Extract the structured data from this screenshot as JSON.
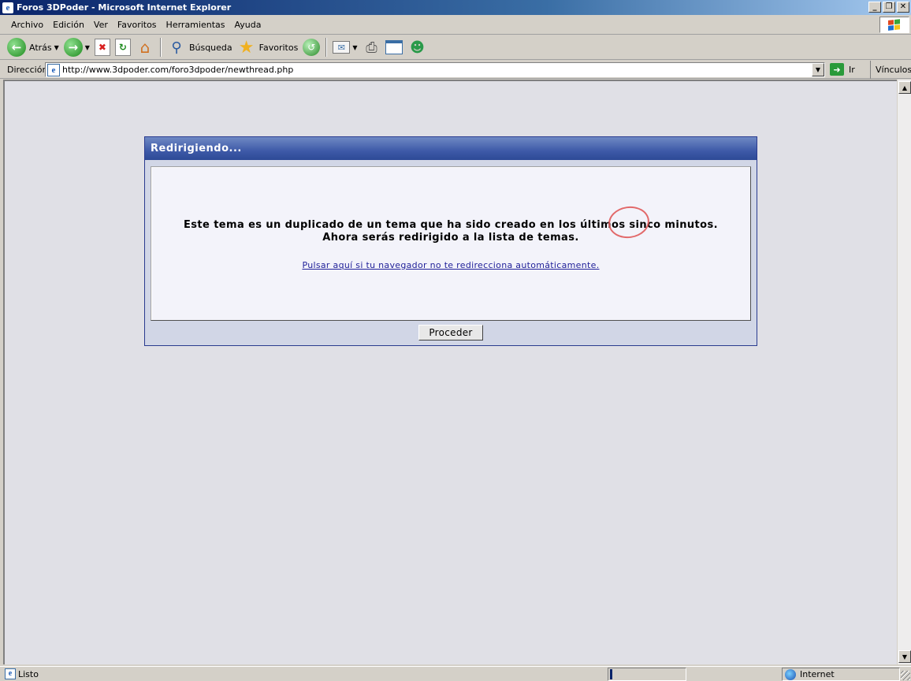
{
  "window": {
    "title": "Foros 3DPoder - Microsoft Internet Explorer",
    "app_icon_glyph": "e",
    "controls": {
      "minimize": "_",
      "restore": "❐",
      "close": "✕"
    }
  },
  "menu": {
    "items": [
      {
        "label": "Archivo"
      },
      {
        "label": "Edición"
      },
      {
        "label": "Ver"
      },
      {
        "label": "Favoritos"
      },
      {
        "label": "Herramientas"
      },
      {
        "label": "Ayuda"
      }
    ]
  },
  "toolbar": {
    "back_label": "Atrás",
    "search_label": "Búsqueda",
    "favorites_label": "Favoritos",
    "icons": [
      "back-icon",
      "forward-icon",
      "stop-icon",
      "refresh-icon",
      "home-icon",
      "search-icon",
      "favorites-icon",
      "history-icon",
      "mail-icon",
      "print-icon",
      "edit-icon",
      "messenger-icon"
    ]
  },
  "address": {
    "label": "Dirección",
    "url": "http://www.3dpoder.com/foro3dpoder/newthread.php",
    "go_label": "Ir",
    "links_label": "Vínculos"
  },
  "page": {
    "panel_title": "Redirigiendo...",
    "message_line1": "Este tema es un duplicado de un tema que ha sido creado en los últimos sinco minutos.",
    "message_line2": "Ahora serás redirigido a la lista de temas.",
    "redirect_link": "Pulsar aquí si tu navegador no te redirecciona automáticamente.",
    "proceed_button": "Proceder"
  },
  "status": {
    "text": "Listo",
    "zone": "Internet",
    "progress_fraction": 0.03
  },
  "colors": {
    "title_bar": "#0a246a",
    "panel_header": "#3e5aa8",
    "panel_border": "#2a3b8f",
    "link": "#22229a",
    "annotation_circle": "#e05a5a",
    "content_bg": "#e0e0e6"
  }
}
